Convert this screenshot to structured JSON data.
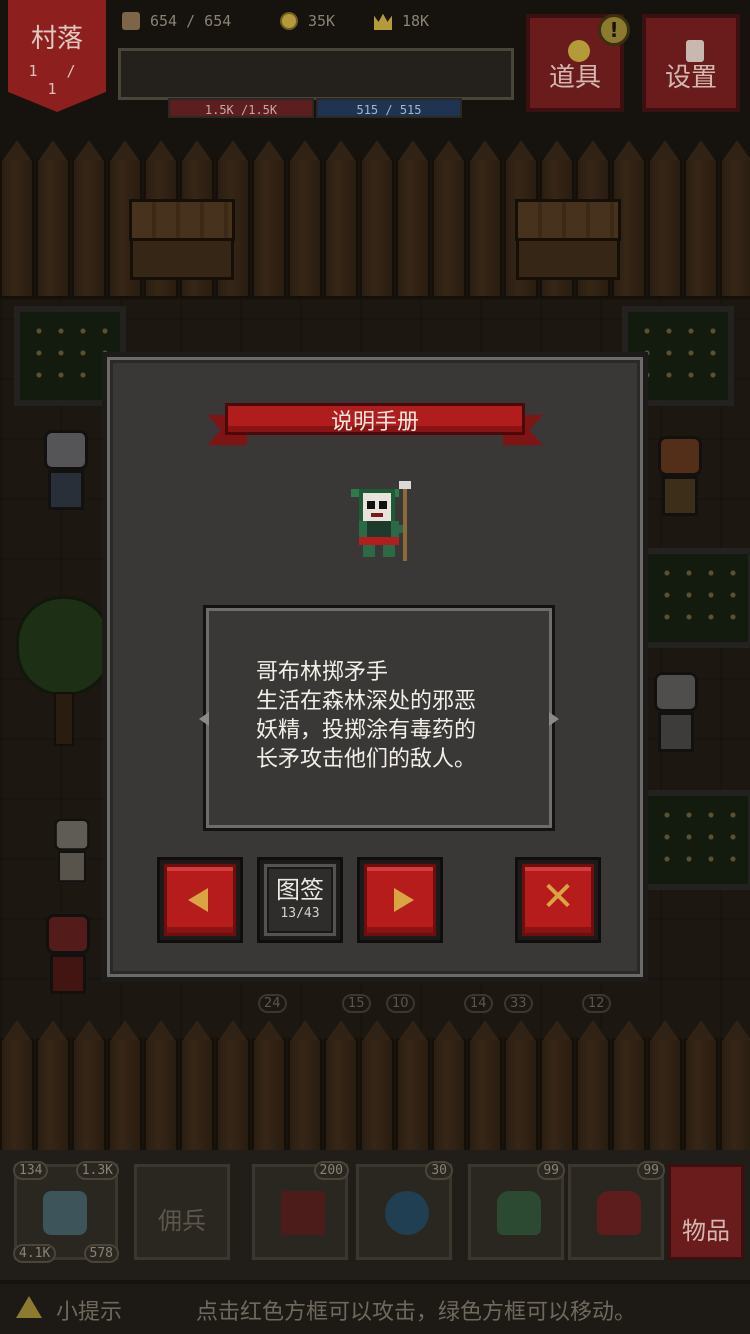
{
  "hud": {
    "village_name": "村落",
    "village_level": "1 / 1",
    "food": "654 / 654",
    "gold": "35K",
    "fame": "18K",
    "hp_bar": "1.5K /1.5K",
    "mp_bar": "515 / 515",
    "items_button": "道具",
    "settings_button": "设置",
    "alert_mark": "!"
  },
  "dialog": {
    "title": "说明手册",
    "entry_name": "哥布林掷矛手",
    "description_line1": "生活在森林深处的邪恶",
    "description_line2": "妖精，投掷涂有毒药的",
    "description_line3": "长矛攻击他们的敌人。",
    "tag_label": "图签",
    "tag_count": "13/43",
    "close_symbol": "✕"
  },
  "field_units": [
    "24",
    "15",
    "10",
    "14",
    "33",
    "12"
  ],
  "bottom": {
    "hero_stats": {
      "top_left": "134",
      "top_right": "1.3K",
      "bottom_left": "4.1K",
      "bottom_right": "578"
    },
    "mercenary_label": "佣兵",
    "skill1_count": "200",
    "skill2_count": "30",
    "potion_green_count": "99",
    "potion_red_count": "99",
    "goods_label": "物品"
  },
  "hint": {
    "label": "小提示",
    "text": "点击红色方框可以攻击，绿色方框可以移动。"
  },
  "colors": {
    "accent_red": "#b71c1c",
    "arrow_gold": "#d9a441",
    "panel_gray": "#3a3836"
  }
}
